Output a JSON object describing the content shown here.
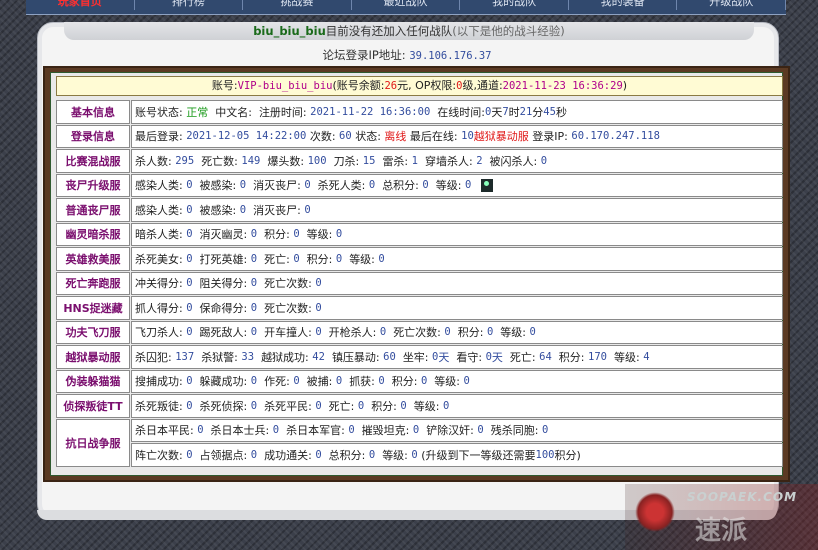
{
  "nav": [
    "玩家首页",
    "排行榜",
    "挑战赛",
    "最近战队",
    "我的战队",
    "我的装备",
    "升级战队"
  ],
  "title": {
    "player": "biu_biu_biu",
    "text": "目前没有还加入任何战队",
    "note": "(以下是他的战斗经验)"
  },
  "ip": {
    "label": "论坛登录IP地址:",
    "value": "39.106.176.37"
  },
  "account": {
    "label": "账号:",
    "name": "VIP-biu_biu_biu",
    "balance_label": "(账号余额:",
    "balance": "26",
    "balance_unit": "元",
    "op_label": ", OP权限:",
    "op": "0",
    "op_unit": "级",
    "channel_label": ",通道:",
    "channel_time": "2021-11-23 16:36:29",
    "close": ")"
  },
  "basic": {
    "label": "基本信息",
    "status_label": "账号状态:",
    "status": "正常",
    "cn_label": "中文名:",
    "reg_label": "注册时间:",
    "reg": "2021-11-22 16:36:00",
    "online_label": "在线时间:",
    "d": "0",
    "d_unit": "天",
    "h": "7",
    "h_unit": "时",
    "m": "21",
    "m_unit": "分",
    "s": "45",
    "s_unit": "秒"
  },
  "login": {
    "label": "登录信息",
    "last_label": "最后登录:",
    "last": "2021-12-05 14:22:00",
    "count_label": "次数:",
    "count": "60",
    "state_label": "状态:",
    "state": "离线",
    "online_label": "最后在线:",
    "online_num": "10",
    "online_srv": "越狱暴动服",
    "ip_label": "登录IP:",
    "ip": "60.170.247.118"
  },
  "rows": [
    {
      "label": "比赛混战服",
      "items": [
        [
          "杀人数:",
          "295"
        ],
        [
          "死亡数:",
          "149"
        ],
        [
          "爆头数:",
          "100"
        ],
        [
          "刀杀:",
          "15"
        ],
        [
          "雷杀:",
          "1"
        ],
        [
          "穿墙杀人:",
          "2"
        ],
        [
          "被闪杀人:",
          "0"
        ]
      ],
      "last": ""
    },
    {
      "label": "丧尸升级服",
      "items": [
        [
          "感染人类:",
          "0"
        ],
        [
          "被感染:",
          "0"
        ],
        [
          "消灭丧尸:",
          "0"
        ],
        [
          "杀死人类:",
          "0"
        ],
        [
          "总积分:",
          "0"
        ],
        [
          "等级:",
          "0"
        ]
      ],
      "last": "",
      "avatar": true
    },
    {
      "label": "普通丧尸服",
      "items": [
        [
          "感染人类:",
          "0"
        ],
        [
          "被感染:",
          "0"
        ],
        [
          "消灭丧尸:",
          "0"
        ]
      ],
      "last": ""
    },
    {
      "label": "幽灵暗杀服",
      "items": [
        [
          "暗杀人类:",
          "0"
        ],
        [
          "消灭幽灵:",
          "0"
        ],
        [
          "积分:",
          "0"
        ]
      ],
      "last_label": "等级:",
      "last": "0"
    },
    {
      "label": "英雄救美服",
      "items": [
        [
          "杀死美女:",
          "0"
        ],
        [
          "打死英雄:",
          "0"
        ],
        [
          "死亡:",
          "0"
        ],
        [
          "积分:",
          "0"
        ]
      ],
      "last_label": "等级:",
      "last": "0"
    },
    {
      "label": "死亡奔跑服",
      "items": [
        [
          "冲关得分:",
          "0"
        ],
        [
          "阻关得分:",
          "0"
        ],
        [
          "死亡次数:",
          "0"
        ]
      ],
      "last": ""
    },
    {
      "label": "HNS捉迷藏",
      "items": [
        [
          "抓人得分:",
          "0"
        ],
        [
          "保命得分:",
          "0"
        ],
        [
          "死亡次数:",
          "0"
        ]
      ],
      "last": ""
    },
    {
      "label": "功夫飞刀服",
      "items": [
        [
          "飞刀杀人:",
          "0"
        ],
        [
          "踢死敌人:",
          "0"
        ],
        [
          "开车撞人:",
          "0"
        ],
        [
          "开枪杀人:",
          "0"
        ],
        [
          "死亡次数:",
          "0"
        ],
        [
          "积分:",
          "0"
        ],
        [
          "等级:",
          "0"
        ]
      ],
      "last": ""
    },
    {
      "label": "越狱暴动服",
      "items": [
        [
          "杀囚犯:",
          "137"
        ],
        [
          "杀狱警:",
          "33"
        ],
        [
          "越狱成功:",
          "42"
        ],
        [
          "镇压暴动:",
          "60"
        ]
      ],
      "jail": {
        "sit_label": "坐牢:",
        "sit": "0",
        "sit_unit": "天",
        "watch_label": "看守:",
        "watch": "0",
        "watch_unit": "天",
        "death_label": "死亡:",
        "death": "64",
        "score_label": "积分:",
        "score": "170",
        "level_label": "等级:",
        "level": "4"
      }
    },
    {
      "label": "伪装躲猫猫",
      "items": [
        [
          "搜捕成功:",
          "0"
        ],
        [
          "躲藏成功:",
          "0"
        ],
        [
          "作死:",
          "0"
        ],
        [
          "被捕:",
          "0"
        ],
        [
          "抓获:",
          "0"
        ],
        [
          "积分:",
          "0"
        ]
      ],
      "last_label": "等级:",
      "last": "0"
    },
    {
      "label": "侦探叛徒TT",
      "items": [
        [
          "杀死叛徒:",
          "0"
        ],
        [
          "杀死侦探:",
          "0"
        ],
        [
          "杀死平民:",
          "0"
        ],
        [
          "死亡:",
          "0"
        ],
        [
          "积分:",
          "0"
        ]
      ],
      "last_label": "等级:",
      "last": "0"
    }
  ],
  "war": {
    "label": "抗日战争服",
    "line1": [
      [
        "杀日本平民:",
        "0"
      ],
      [
        "杀日本士兵:",
        "0"
      ],
      [
        "杀日本军官:",
        "0"
      ],
      [
        "摧毁坦克:",
        "0"
      ],
      [
        "铲除汉奸:",
        "0"
      ],
      [
        "残杀同胞:",
        "0"
      ]
    ],
    "line2": [
      [
        "阵亡次数:",
        "0"
      ],
      [
        "占领据点:",
        "0"
      ],
      [
        "成功通关:",
        "0"
      ],
      [
        "总积分:",
        "0"
      ]
    ],
    "level_label": "等级:",
    "level": "0",
    "upgrade_pre": "(升级到下一等级还需要",
    "upgrade": "100",
    "upgrade_post": "积分)"
  },
  "logo": {
    "en": "SOOPAEK.COM",
    "cn": "速派"
  }
}
